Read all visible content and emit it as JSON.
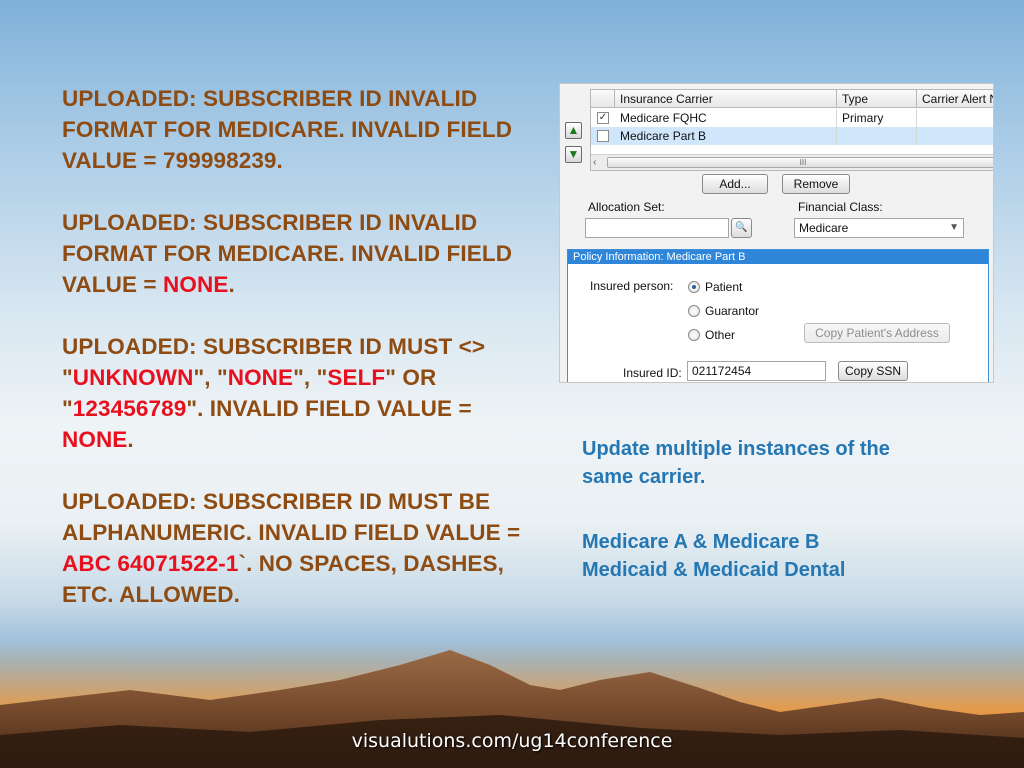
{
  "errors": [
    [
      {
        "t": "UPLOADED: SUBSCRIBER ID INVALID FORMAT FOR MEDICARE. INVALID FIELD VALUE = 799998239.",
        "red": false
      }
    ],
    [
      {
        "t": "UPLOADED: SUBSCRIBER ID INVALID FORMAT FOR MEDICARE. INVALID FIELD VALUE = ",
        "red": false
      },
      {
        "t": "NONE",
        "red": true
      },
      {
        "t": ".",
        "red": false
      }
    ],
    [
      {
        "t": "UPLOADED: SUBSCRIBER ID MUST <> \"",
        "red": false
      },
      {
        "t": "UNKNOWN",
        "red": true
      },
      {
        "t": "\", \"",
        "red": false
      },
      {
        "t": "NONE",
        "red": true
      },
      {
        "t": "\", \"",
        "red": false
      },
      {
        "t": "SELF",
        "red": true
      },
      {
        "t": "\" OR \"",
        "red": false
      },
      {
        "t": "123456789",
        "red": true
      },
      {
        "t": "\".  INVALID FIELD VALUE = ",
        "red": false
      },
      {
        "t": "NONE",
        "red": true
      },
      {
        "t": ".",
        "red": false
      }
    ],
    [
      {
        "t": "UPLOADED: SUBSCRIBER ID MUST BE ALPHANUMERIC. INVALID FIELD VALUE = ",
        "red": false
      },
      {
        "t": "ABC 64071522-1",
        "red": true
      },
      {
        "t": "`. NO SPACES, DASHES, ETC. ALLOWED.",
        "red": false
      }
    ]
  ],
  "grid": {
    "columns": [
      "Insurance Carrier",
      "Type",
      "Carrier Alert N"
    ],
    "rows": [
      {
        "checked": "✓",
        "carrier": "Medicare FQHC",
        "type": "Primary",
        "alert": ""
      },
      {
        "checked": "",
        "carrier": "Medicare Part B",
        "type": "",
        "alert": ""
      }
    ],
    "scroll_grip": "III",
    "scroll_left": "‹"
  },
  "icons": {
    "up": "▲",
    "down": "▼",
    "search": "🔍",
    "dropdown": "▼"
  },
  "buttons": {
    "add": "Add...",
    "remove": "Remove",
    "copy_address": "Copy Patient's Address",
    "copy_ssn": "Copy SSN"
  },
  "allocation": {
    "label": "Allocation Set:",
    "value": ""
  },
  "financial": {
    "label": "Financial Class:",
    "value": "Medicare"
  },
  "policy": {
    "title": "Policy Information: Medicare Part B",
    "insured_label": "Insured person:",
    "options": [
      "Patient",
      "Guarantor",
      "Other"
    ],
    "selected": "Patient",
    "insured_id_label": "Insured ID:",
    "insured_id": "021172454"
  },
  "notes": {
    "line1": "Update multiple instances of the",
    "line2": "same carrier.",
    "line3": "Medicare A & Medicare B",
    "line4": "Medicaid & Medicaid Dental"
  },
  "footer": "visualutions.com/ug14conference",
  "colors": {
    "body_text": "#8e4b12",
    "highlight": "#e8101e",
    "note": "#2477b3",
    "policy_header": "#2f86d9"
  }
}
